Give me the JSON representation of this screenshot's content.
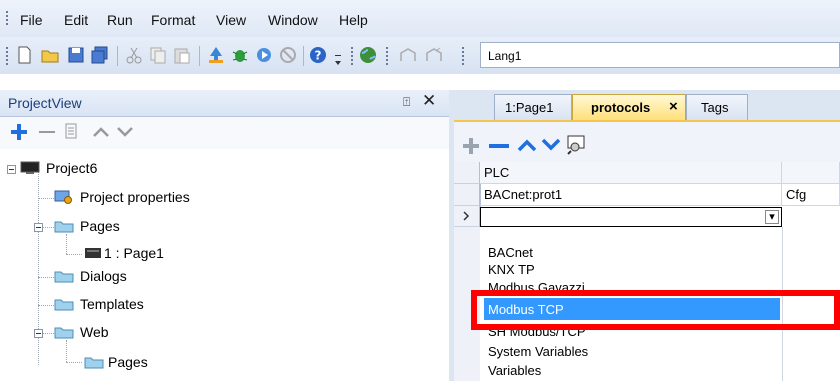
{
  "menu": [
    "File",
    "Edit",
    "Run",
    "Format",
    "View",
    "Window",
    "Help"
  ],
  "toolbar": {
    "icons": [
      "new-icon",
      "open-icon",
      "save-icon",
      "save-all-icon",
      "cut-icon",
      "copy-icon",
      "paste-icon",
      "run-icon",
      "debug-icon",
      "play-icon",
      "stop-icon",
      "help-icon",
      "globe-icon",
      "undo-icon",
      "redo-icon"
    ],
    "language": "Lang1"
  },
  "project_view": {
    "title": "ProjectView",
    "pin_glyph": "⍐",
    "close_glyph": "✕",
    "tools": [
      "add-icon",
      "remove-icon",
      "properties-icon",
      "move-up-icon",
      "move-down-icon"
    ],
    "tree": {
      "project": "Project6",
      "project_properties": "Project properties",
      "pages": "Pages",
      "page1": "1 : Page1",
      "dialogs": "Dialogs",
      "templates": "Templates",
      "web": "Web",
      "web_pages": "Pages"
    }
  },
  "editor": {
    "tabs": {
      "page1": "1:Page1",
      "protocols": "protocols",
      "protocols_close": "×",
      "tags": "Tags"
    },
    "grid": {
      "header": "PLC",
      "row1": "BACnet:prot1",
      "row1_extra": "Cfg",
      "dropdown_arrow": "▾"
    },
    "dropdown_options": [
      "BACnet",
      "KNX TP",
      "Modbus Gavazzi",
      "Modbus TCP",
      "SH Modbus/TCP",
      "System Variables",
      "Variables"
    ],
    "selected_option": "Modbus TCP"
  },
  "colors": {
    "highlight": "#3399ff",
    "annotation": "#ff0000",
    "tab_active": "#ffe07a",
    "add": "#1f6fe0"
  }
}
